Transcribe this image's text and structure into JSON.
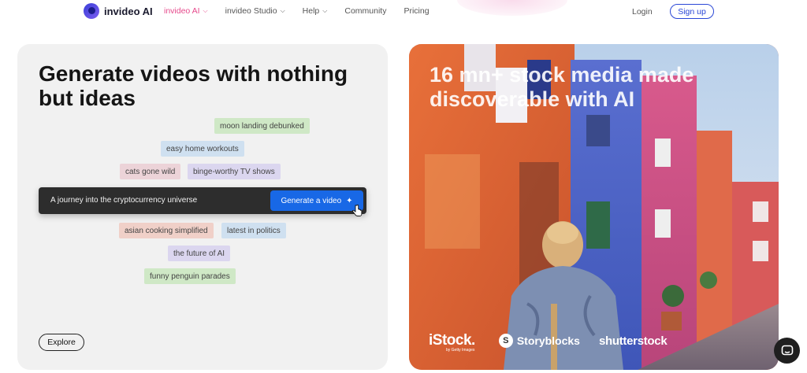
{
  "nav": {
    "brand": "invideo AI",
    "links": [
      {
        "label": "invideo AI",
        "has_dropdown": true,
        "active": true
      },
      {
        "label": "invideo Studio",
        "has_dropdown": true,
        "active": false
      },
      {
        "label": "Help",
        "has_dropdown": true,
        "active": false
      },
      {
        "label": "Community",
        "has_dropdown": false,
        "active": false
      },
      {
        "label": "Pricing",
        "has_dropdown": false,
        "active": false
      }
    ],
    "login": "Login",
    "signup": "Sign up"
  },
  "left_card": {
    "title": "Generate videos with nothing\nbut ideas",
    "chips": [
      {
        "label": "moon landing debunked",
        "color": "green"
      },
      {
        "label": "easy home workouts",
        "color": "blue"
      },
      {
        "label": "cats gone wild",
        "color": "pink"
      },
      {
        "label": "binge-worthy TV shows",
        "color": "lavender"
      },
      {
        "label": "asian cooking simplified",
        "color": "salmon"
      },
      {
        "label": "latest in politics",
        "color": "blue"
      },
      {
        "label": "the future of AI",
        "color": "lavender"
      },
      {
        "label": "funny penguin parades",
        "color": "green"
      }
    ],
    "prompt_text": "A journey into the cryptocurrency universe",
    "generate_button": "Generate a video",
    "explore_button": "Explore"
  },
  "right_card": {
    "title": "16 mn+ stock media made\ndiscoverable with AI",
    "brands": {
      "istock": "iStock.",
      "istock_sub": "by Getty Images",
      "storyblocks": "Storyblocks",
      "storyblocks_icon": "S",
      "shutterstock": "shutterstock"
    }
  },
  "colors": {
    "accent_pink": "#e64a8c",
    "accent_blue": "#2a47d6",
    "generate_blue": "#1868e6"
  },
  "icons": {
    "logo": "invideo-logo-icon",
    "dropdown": "chevron-down-icon",
    "sparkle": "sparkle-icon",
    "cursor": "hand-pointer-icon",
    "chat": "chat-bubble-icon"
  }
}
